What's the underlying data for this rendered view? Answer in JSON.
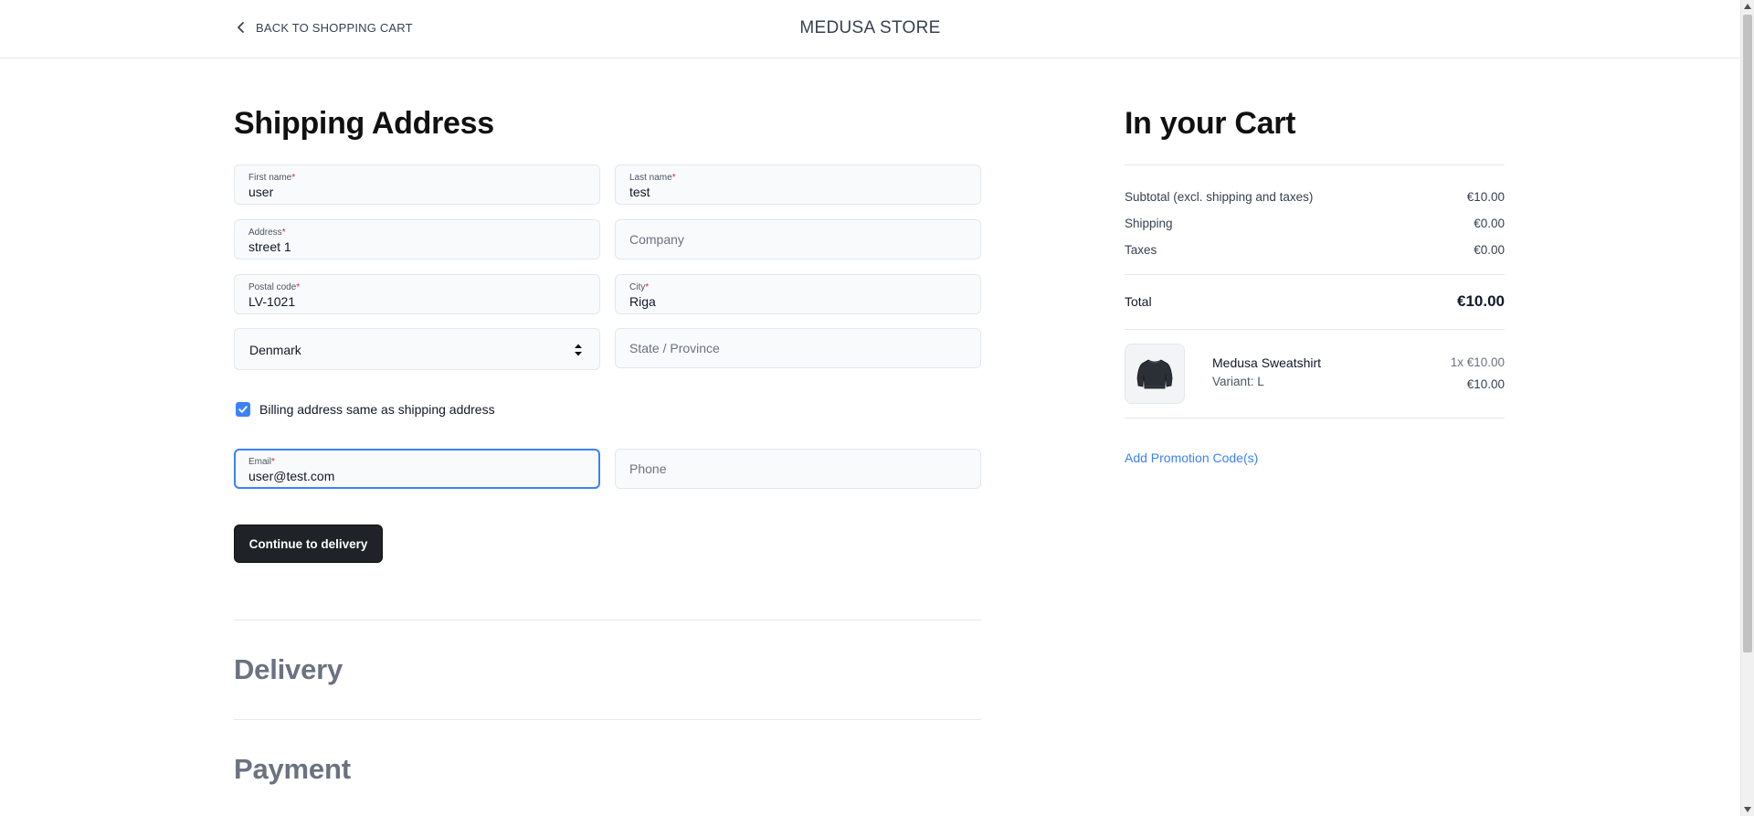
{
  "header": {
    "back_label": "BACK TO SHOPPING CART",
    "store_name": "MEDUSA STORE"
  },
  "shipping": {
    "heading": "Shipping Address",
    "first_name": {
      "label": "First name",
      "value": "user"
    },
    "last_name": {
      "label": "Last name",
      "value": "test"
    },
    "address": {
      "label": "Address",
      "value": "street 1"
    },
    "company": {
      "placeholder": "Company"
    },
    "postal_code": {
      "label": "Postal code",
      "value": "LV-1021"
    },
    "city": {
      "label": "City",
      "value": "Riga"
    },
    "country": {
      "selected": "Denmark"
    },
    "province": {
      "placeholder": "State / Province"
    },
    "billing_same": {
      "label": "Billing address same as shipping address",
      "checked": true
    },
    "email": {
      "label": "Email",
      "value": "user@test.com"
    },
    "phone": {
      "placeholder": "Phone"
    },
    "required_marker": "*",
    "continue_label": "Continue to delivery"
  },
  "sections": {
    "delivery": "Delivery",
    "payment": "Payment"
  },
  "cart": {
    "heading": "In your Cart",
    "subtotal": {
      "label": "Subtotal (excl. shipping and taxes)",
      "value": "€10.00"
    },
    "shipping": {
      "label": "Shipping",
      "value": "€0.00"
    },
    "taxes": {
      "label": "Taxes",
      "value": "€0.00"
    },
    "total": {
      "label": "Total",
      "value": "€10.00"
    },
    "items": [
      {
        "name": "Medusa Sweatshirt",
        "variant": "Variant: L",
        "qty_price": "1x €10.00",
        "line_total": "€10.00",
        "icon": "sweatshirt-icon"
      }
    ],
    "promo_label": "Add Promotion Code(s)"
  },
  "colors": {
    "accent": "#3b82f6",
    "button_bg": "#1f2227",
    "required": "#e11d48",
    "muted_heading": "#6b7280"
  }
}
